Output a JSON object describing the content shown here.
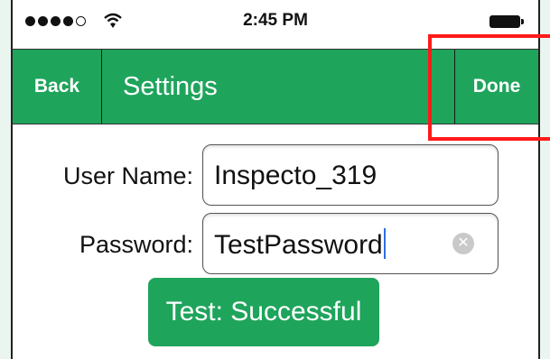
{
  "status_bar": {
    "time": "2:45 PM",
    "signal_icon": "signal-dots-icon",
    "wifi_icon": "wifi-icon",
    "battery_icon": "battery-icon"
  },
  "nav": {
    "back_label": "Back",
    "title": "Settings",
    "done_label": "Done",
    "accent_color": "#1fa45c"
  },
  "form": {
    "username_label": "User Name:",
    "username_value": "Inspecto_319",
    "password_label": "Password:",
    "password_value": "TestPassword",
    "clear_icon": "clear-icon"
  },
  "test_button": {
    "label": "Test: Successful"
  },
  "annotation": {
    "highlight_color": "#ff1a1a"
  }
}
